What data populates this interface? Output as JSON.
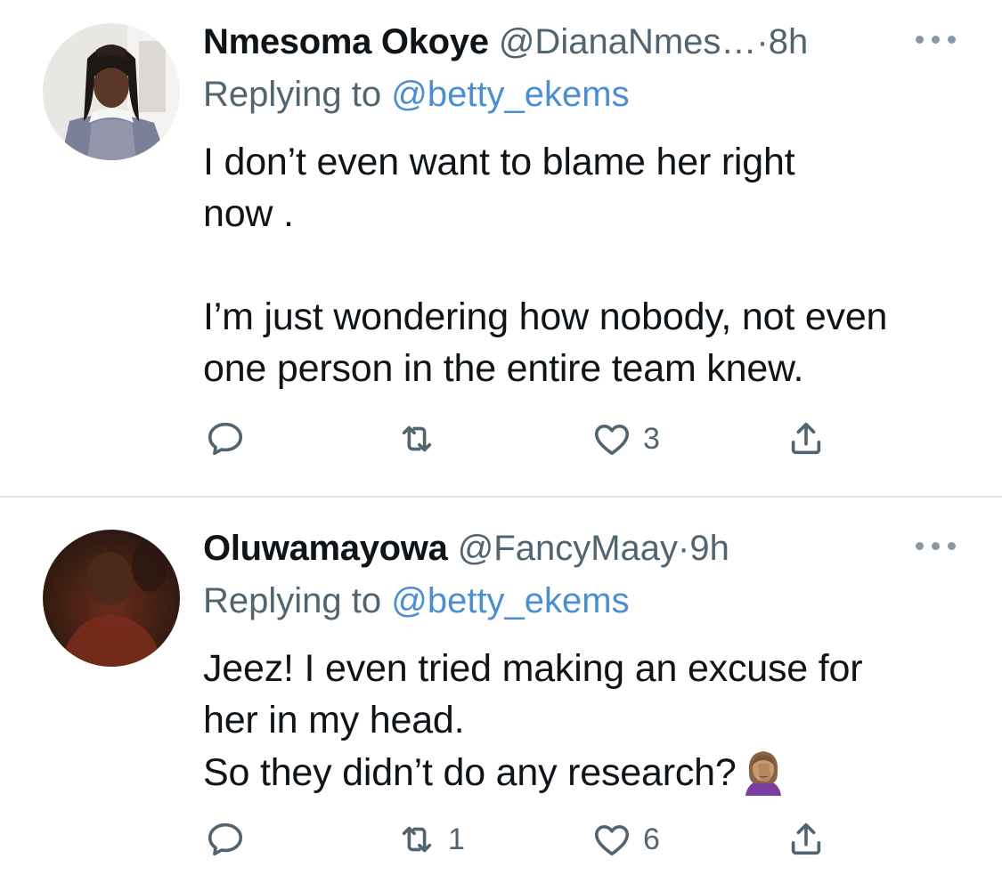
{
  "tweets": [
    {
      "display_name": "Nmesoma Okoye",
      "handle": "@DianaNmes…",
      "separator": "·",
      "time": "8h",
      "replying_prefix": "Replying to ",
      "replying_to": "@betty_ekems",
      "text": "I don’t even want to blame her right\nnow .\n\nI’m just wondering how nobody, not even\none person in the entire team knew.",
      "reply_count": "",
      "retweet_count": "",
      "like_count": "3"
    },
    {
      "display_name": "Oluwamayowa",
      "handle": "@FancyMaay",
      "separator": "·",
      "time": "9h",
      "replying_prefix": "Replying to ",
      "replying_to": "@betty_ekems",
      "text": "Jeez! I even tried making an excuse for\nher in my head.\nSo they didn’t do any research?",
      "trailing_emoji": "woman-facepalming-emoji",
      "reply_count": "",
      "retweet_count": "1",
      "like_count": "6"
    }
  ],
  "icons": {
    "reply": "reply-icon",
    "retweet": "retweet-icon",
    "like": "heart-icon",
    "share": "share-icon",
    "more": "more-dots-icon"
  },
  "colors": {
    "text": "#0f1419",
    "secondary": "#536471",
    "link": "#4b8fd0",
    "divider": "#e1e5e8"
  }
}
